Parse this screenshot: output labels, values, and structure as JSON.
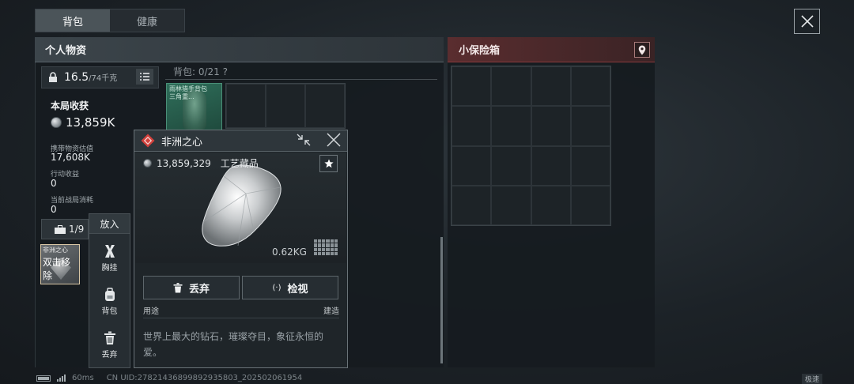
{
  "tabs": [
    {
      "label": "背包",
      "active": true
    },
    {
      "label": "健康",
      "active": false
    }
  ],
  "personal": {
    "title": "个人物资",
    "weight": {
      "current": "16.5",
      "max": "/74千克"
    },
    "harvest": {
      "title": "本局收获",
      "value": "13,859K",
      "stats": [
        {
          "label": "携带物资估值",
          "value": "17,608K"
        },
        {
          "label": "行动收益",
          "value": "0"
        },
        {
          "label": "当前战局消耗",
          "value": "0"
        }
      ]
    },
    "backpack_label": "背包: 0/21  ?",
    "backpack_item": {
      "line1": "雨林猎手背包",
      "line2": "三角重..."
    },
    "chest": {
      "count": "1/9",
      "slot_name": "非洲之心",
      "slot_action": "双击移除"
    }
  },
  "context_menu": {
    "title": "放入",
    "items": [
      {
        "icon": "chest-rig-icon",
        "label": "胸挂"
      },
      {
        "icon": "backpack-icon",
        "label": "背包"
      },
      {
        "icon": "trash-icon",
        "label": "丢弃"
      }
    ]
  },
  "detail": {
    "title": "非洲之心",
    "price": "13,859,329",
    "category": "工艺藏品",
    "weight": "0.62KG",
    "discard_label": "丢弃",
    "inspect_label": "检视",
    "use_label": "用途",
    "use_value": "建造",
    "description": "世界上最大的钻石，璀璨夺目，象征永恒的爱。"
  },
  "safe": {
    "title": "小保险箱"
  },
  "footer": {
    "ping": "60ms",
    "uid": "CN UID:27821436899892935803_202502061954",
    "corner": "极速"
  },
  "colors": {
    "safe_accent": "#8a3a3c",
    "item_green": "#2f6e5a",
    "quality_red": "#d2413c"
  }
}
